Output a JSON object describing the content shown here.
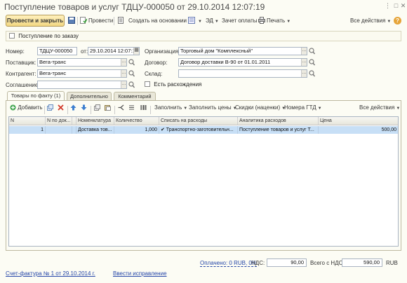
{
  "window": {
    "title": "Поступление товаров и услуг ТДЦУ-000050 от 29.10.2014 12:07:19"
  },
  "toolbar": {
    "post_close_label": "Провести и закрыть",
    "post_label": "Провести",
    "create_based_label": "Создать на основании",
    "ed_label": "ЭД",
    "payment_label": "Зачет оплаты",
    "print_label": "Печать",
    "all_actions_label": "Все действия",
    "help_glyph": "?"
  },
  "order_checkbox": {
    "label": "Поступление по заказу",
    "checked": false
  },
  "form": {
    "number_label": "Номер:",
    "number_value": "ТДЦУ-000050",
    "date_label": "от:",
    "date_value": "29.10.2014 12:07:19",
    "org_label": "Организация:",
    "org_value": "Торговый дом \"Комплексный\"",
    "supplier_label": "Поставщик:",
    "supplier_value": "Вега-транс",
    "contract_label": "Договор:",
    "contract_value": "Договор доставки В-90 от 01.01.2011",
    "counterparty_label": "Контрагент:",
    "counterparty_value": "Вега-транс",
    "warehouse_label": "Склад:",
    "warehouse_value": "",
    "agreement_label": "Соглашение:",
    "agreement_value": "",
    "discrepancy_label": "Есть расхождения"
  },
  "tabs": [
    {
      "label": "Товары по факту (1)",
      "active": true
    },
    {
      "label": "Дополнительно",
      "active": false
    },
    {
      "label": "Комментарий",
      "active": false
    }
  ],
  "table_toolbar": {
    "add_label": "Добавить",
    "fill_label": "Заполнить",
    "fill_prices_label": "Заполнить цены",
    "discounts_label": "Скидки (наценки)",
    "gtd_label": "Номера ГТД",
    "all_actions_label": "Все действия"
  },
  "table": {
    "columns": [
      "N",
      "N по док...",
      "",
      "Номенклатура",
      "Количество",
      "Списать на расходы",
      "Аналитика расходов",
      "Цена"
    ],
    "rows": [
      [
        "1",
        "",
        "",
        "Доставка тов...",
        "1,000",
        "✔ Транспортно-заготовительн...",
        "Поступление товаров и услуг Т...",
        "500,00"
      ]
    ]
  },
  "footer": {
    "paid_link": "Оплачено: 0 RUB, 0%",
    "vat_label": "НДС:",
    "vat_value": "90,00",
    "total_label": "Всего с НДС:",
    "total_value": "590,00",
    "currency": "RUB",
    "invoice_link": "Счет-фактура № 1 от 29.10.2014 г.",
    "correction_link": "Ввести исправление"
  },
  "colors": {
    "accent_button": "#f2d782",
    "selected_row": "#c7dff6",
    "link": "#2546a8"
  }
}
